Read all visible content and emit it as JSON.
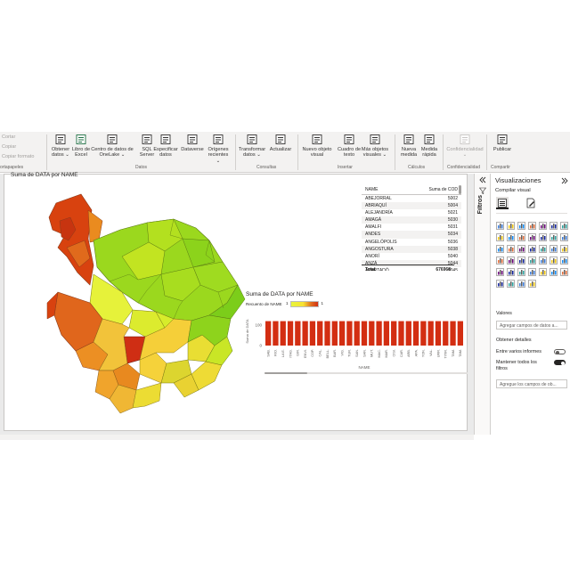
{
  "ribbon": {
    "clipboard_small": [
      "Cortar",
      "Copiar",
      "Copiar formato"
    ],
    "clipboard_group": "ortapapeles",
    "buttons": [
      {
        "id": "obtener",
        "label": "Obtener datos ⌄",
        "icon": "database-icon"
      },
      {
        "id": "excel",
        "label": "Libro de Excel",
        "icon": "excel-icon"
      },
      {
        "id": "onelake",
        "label": "Centro de datos de OneLake ⌄",
        "icon": "onelake-icon"
      },
      {
        "id": "sql",
        "label": "SQL Server",
        "icon": "sql-server-icon"
      },
      {
        "id": "especificar",
        "label": "Especificar datos",
        "icon": "table-icon"
      },
      {
        "id": "dataverse",
        "label": "Dataverse",
        "icon": "dataverse-icon"
      },
      {
        "id": "origenes",
        "label": "Orígenes recientes ⌄",
        "icon": "recent-sources-icon"
      },
      {
        "id": "transformar",
        "label": "Transformar datos ⌄",
        "icon": "transform-icon"
      },
      {
        "id": "actualizar",
        "label": "Actualizar",
        "icon": "refresh-icon"
      },
      {
        "id": "nuevo",
        "label": "Nuevo objeto visual",
        "icon": "new-visual-icon"
      },
      {
        "id": "cuadro",
        "label": "Cuadro de texto",
        "icon": "text-box-icon"
      },
      {
        "id": "mas",
        "label": "Más objetos visuales ⌄",
        "icon": "more-visuals-icon"
      },
      {
        "id": "medida",
        "label": "Nueva medida",
        "icon": "new-measure-icon"
      },
      {
        "id": "rapida",
        "label": "Medida rápida",
        "icon": "quick-measure-icon"
      },
      {
        "id": "conf",
        "label": "Confidencialidad ⌄",
        "icon": "sensitivity-icon"
      },
      {
        "id": "publicar",
        "label": "Publicar",
        "icon": "publish-icon"
      }
    ],
    "groups": [
      "Datos",
      "Consultas",
      "Insertar",
      "Cálculos",
      "Confidencialidad",
      "Compartir"
    ]
  },
  "map_visual": {
    "title": "Suma de DATA por NAME"
  },
  "table_visual": {
    "col_name": "NAME",
    "col_value": "Suma de COD",
    "rows": [
      {
        "name": "ABEJORRAL",
        "value": "5002"
      },
      {
        "name": "ABRIAQUÍ",
        "value": "5004"
      },
      {
        "name": "ALEJANDRÍA",
        "value": "5021"
      },
      {
        "name": "AMAGÁ",
        "value": "5030"
      },
      {
        "name": "AMALFI",
        "value": "5031"
      },
      {
        "name": "ANDES",
        "value": "5034"
      },
      {
        "name": "ANGELÓPOLIS",
        "value": "5036"
      },
      {
        "name": "ANGOSTURA",
        "value": "5038"
      },
      {
        "name": "ANORÍ",
        "value": "5040"
      },
      {
        "name": "ANZÁ",
        "value": "5044"
      },
      {
        "name": "APARTADÓ",
        "value": "5045"
      }
    ],
    "total_label": "Total",
    "total_value": "676968"
  },
  "chart_data": {
    "type": "bar",
    "title": "Suma de DATA por NAME",
    "legend_title": "Recuento de NAME",
    "legend_min": "1",
    "legend_max": "1",
    "xlabel": "NAME",
    "ylabel": "Suma de DATA",
    "y_ticks": [
      "0",
      "100"
    ],
    "ylim": [
      0,
      140
    ],
    "categories": [
      "SAB.",
      "RIO.",
      "LA E.",
      "ITAG.",
      "GIR.",
      "ENVI.",
      "COP.",
      "CAL.",
      "BELL.",
      "BAR.",
      "VIG.",
      "TUR.",
      "SAN.",
      "SAN.",
      "MUT.",
      "MAC.",
      "MAR.",
      "CISI.",
      "CAR.",
      "ARB.",
      "APA.",
      "YON.",
      "VAL.",
      "URR.",
      "TITIR.",
      "TAM.",
      "TAM."
    ],
    "values": [
      120,
      120,
      120,
      120,
      120,
      120,
      120,
      120,
      120,
      120,
      120,
      120,
      120,
      120,
      120,
      120,
      120,
      120,
      120,
      120,
      120,
      120,
      120,
      120,
      120,
      120,
      120
    ],
    "bar_color": "#d32e12"
  },
  "filters_pane": {
    "label": "Filtros"
  },
  "viz_pane": {
    "title": "Visualizaciones",
    "subtitle": "Compilar visual",
    "values_label": "Valores",
    "values_placeholder": "Agregar campos de datos a...",
    "drill_label": "Obtener detalles",
    "cross_report": "Entre varios informes",
    "keep_filters": "Mantener todos los filtros",
    "drill_placeholder": "Agregue los campos de ob..."
  },
  "colors": {
    "accent": "#d32e12",
    "toggle_on": "#252423",
    "ribbon_bg": "#f3f2f1"
  }
}
